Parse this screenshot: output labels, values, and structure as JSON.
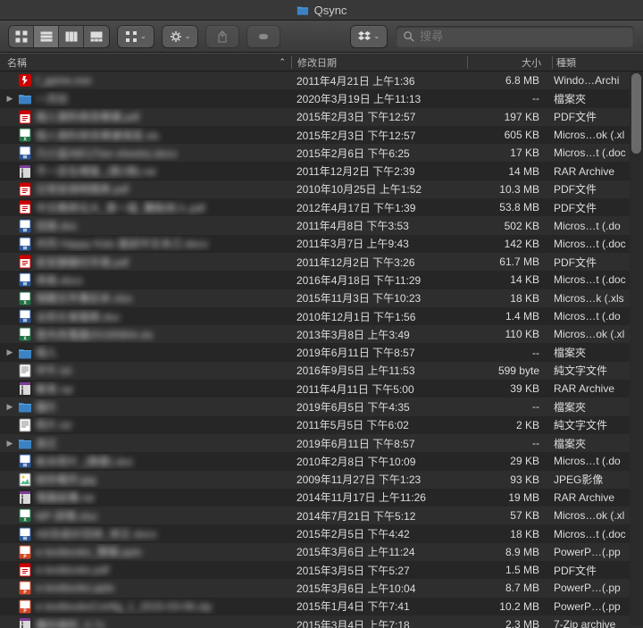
{
  "title": "Qsync",
  "search": {
    "placeholder": "搜尋"
  },
  "columns": {
    "name": "名稱",
    "date": "修改日期",
    "size": "大小",
    "kind": "種類"
  },
  "files": [
    {
      "name": "f_game.exe",
      "date": "2011年4月21日 上午1:36",
      "size": "6.8 MB",
      "kind": "Windo…Archi",
      "icon": "flash",
      "folder": false
    },
    {
      "name": "一月份",
      "date": "2020年3月19日 上午11:13",
      "size": "--",
      "kind": "檔案夾",
      "icon": "folder",
      "folder": true
    },
    {
      "name": "個人資料修改單據.pdf",
      "date": "2015年2月3日 下午12:57",
      "size": "197 KB",
      "kind": "PDF文件",
      "icon": "pdf",
      "folder": false
    },
    {
      "name": "個人資料修改單據填寫.xls",
      "date": "2015年2月3日 下午12:57",
      "size": "605 KB",
      "kind": "Micros…ok (.xl",
      "icon": "xls",
      "folder": false
    },
    {
      "name": "力小盃ABC(Two sheets).docx",
      "date": "2015年2月6日 下午6:25",
      "size": "17 KB",
      "kind": "Micros…t (.doc",
      "icon": "doc",
      "folder": false
    },
    {
      "name": "不一定在裡面_(第2冊).rar",
      "date": "2011年12月2日 下午2:39",
      "size": "14 MB",
      "kind": "RAR Archive",
      "icon": "rar",
      "folder": false
    },
    {
      "name": "日常安排時間表.pdf",
      "date": "2010年10月25日 上午1:52",
      "size": "10.3 MB",
      "kind": "PDF文件",
      "icon": "pdf",
      "folder": false
    },
    {
      "name": "中文教師北大_第一版_難點收入.pdf",
      "date": "2012年4月17日 下午1:39",
      "size": "53.8 MB",
      "kind": "PDF文件",
      "icon": "pdf",
      "folder": false
    },
    {
      "name": "目錄.doc",
      "date": "2011年4月8日 下午3:53",
      "size": "502 KB",
      "kind": "Micros…t (.do",
      "icon": "doc",
      "folder": false
    },
    {
      "name": "共同 Happy Kids 面試中文本己.docx",
      "date": "2011年3月7日 上午9:43",
      "size": "142 KB",
      "kind": "Micros…t (.doc",
      "icon": "doc",
      "folder": false
    },
    {
      "name": "安安靜靜印手冊.pdf",
      "date": "2011年12月2日 下午3:26",
      "size": "61.7 MB",
      "kind": "PDF文件",
      "icon": "pdf",
      "folder": false
    },
    {
      "name": "表格.docx",
      "date": "2016年4月18日 下午11:29",
      "size": "14 KB",
      "kind": "Micros…t (.doc",
      "icon": "doc",
      "folder": false
    },
    {
      "name": "相關文件筆記本.xlsx",
      "date": "2015年11月3日 下午10:23",
      "size": "18 KB",
      "kind": "Micros…k (.xls",
      "icon": "xls",
      "folder": false
    },
    {
      "name": "全民社會服務.doc",
      "date": "2010年12月1日 下午1:56",
      "size": "1.4 MB",
      "kind": "Micros…t (.do",
      "icon": "doc",
      "folder": false
    },
    {
      "name": "室內充電器20190904.xls",
      "date": "2013年3月8日 上午3:49",
      "size": "110 KB",
      "kind": "Micros…ok (.xl",
      "icon": "xls",
      "folder": false
    },
    {
      "name": "個人",
      "date": "2019年6月11日 下午8:57",
      "size": "--",
      "kind": "檔案夾",
      "icon": "folder",
      "folder": true
    },
    {
      "name": "中午.txt",
      "date": "2016年9月5日 上午11:53",
      "size": "599 byte",
      "kind": "純文字文件",
      "icon": "txt",
      "folder": false
    },
    {
      "name": "教育.rar",
      "date": "2011年4月11日 下午5:00",
      "size": "39 KB",
      "kind": "RAR Archive",
      "icon": "rar",
      "folder": false
    },
    {
      "name": "圖片",
      "date": "2019年6月5日 下午4:35",
      "size": "--",
      "kind": "檔案夾",
      "icon": "folder",
      "folder": true
    },
    {
      "name": "照片.txt",
      "date": "2011年5月5日 下午6:02",
      "size": "2 KB",
      "kind": "純文字文件",
      "icon": "txt",
      "folder": false
    },
    {
      "name": "其它",
      "date": "2019年6月11日 下午8:57",
      "size": "--",
      "kind": "檔案夾",
      "icon": "folder",
      "folder": true
    },
    {
      "name": "紙本照片_(簡要).doc",
      "date": "2010年2月8日 下午10:09",
      "size": "29 KB",
      "kind": "Micros…t (.do",
      "icon": "doc",
      "folder": false
    },
    {
      "name": "給你看的.jpg",
      "date": "2009年11月27日 下午1:23",
      "size": "93 KB",
      "kind": "JPEG影像",
      "icon": "jpg",
      "folder": false
    },
    {
      "name": "電腦設備.rar",
      "date": "2014年11月17日 上午11:26",
      "size": "19 MB",
      "kind": "RAR Archive",
      "icon": "rar",
      "folder": false
    },
    {
      "name": "MP 詳情.xlsx",
      "date": "2014年7月21日 下午5:12",
      "size": "57 KB",
      "kind": "Micros…ok (.xl",
      "icon": "xls",
      "folder": false
    },
    {
      "name": "AB及設計回收_修正.docx",
      "date": "2015年2月5日 下午4:42",
      "size": "18 KB",
      "kind": "Micros…t (.doc",
      "icon": "doc",
      "folder": false
    },
    {
      "name": "e-textbooks_簡報.pptx",
      "date": "2015年3月6日 上午11:24",
      "size": "8.9 MB",
      "kind": "PowerP…(.pp",
      "icon": "ppt",
      "folder": false
    },
    {
      "name": "e-textbooks.pdf",
      "date": "2015年3月5日 下午5:27",
      "size": "1.5 MB",
      "kind": "PDF文件",
      "icon": "pdf",
      "folder": false
    },
    {
      "name": "e-textbooks.pptx",
      "date": "2015年3月6日 上午10:04",
      "size": "8.7 MB",
      "kind": "PowerP…(.pp",
      "icon": "ppt",
      "folder": false
    },
    {
      "name": "e-textbooksConfig_1_2015-03-06.zip",
      "date": "2015年1月4日 下午7:41",
      "size": "10.2 MB",
      "kind": "PowerP…(.pp",
      "icon": "ppt",
      "folder": false
    },
    {
      "name": "備份資料_0.7z",
      "date": "2015年3月4日 上午7:18",
      "size": "2.3 MB",
      "kind": "7-Zip archive",
      "icon": "zip",
      "folder": false
    }
  ]
}
